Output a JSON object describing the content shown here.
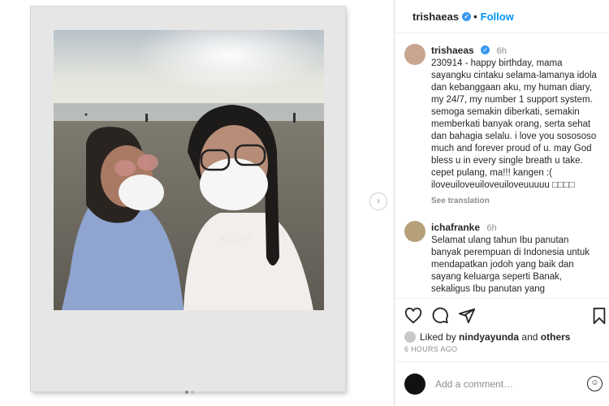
{
  "post": {
    "username": "trishaeas",
    "follow_label": "Follow",
    "next_arrow": "›",
    "verified_icon": "verified-badge-icon",
    "accent": "#0095f6"
  },
  "comments": [
    {
      "username": "trishaeas",
      "time": "6h",
      "text": "230914 - happy birthday, mama sayangku cintaku selama-lamanya idola dan kebanggaan aku, my human diary, my 24/7, my number 1 support system. semoga semakin diberkati, semakin memberkati banyak orang, serta sehat dan bahagia selalu. i love you sosososo much and forever proud of u. may God bless u in every single breath u take. cepet pulang, ma!!! kangen :( iloveuiloveuiloveuiloveuuuuu □□□□",
      "see_translation": "See translation"
    },
    {
      "username": "ichafranke",
      "time": "6h",
      "text": "Selamat ulang tahun Ibu panutan banyak perempuan di Indonesia untuk mendapatkan jodoh yang baik dan sayang keluarga seperti Banak, sekaligus Ibu panutan yang"
    }
  ],
  "likes": {
    "prefix": "Liked by",
    "user": "nindyayunda",
    "and": "and",
    "others": "others"
  },
  "timestamp": "6 HOURS AGO",
  "add_comment": {
    "placeholder": "Add a comment…",
    "emoji": "☺"
  }
}
